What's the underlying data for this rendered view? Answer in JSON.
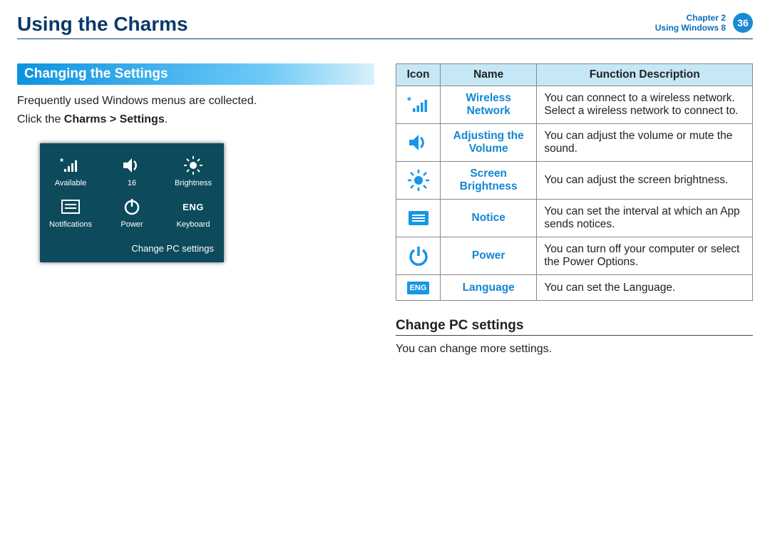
{
  "header": {
    "title": "Using the Charms",
    "chapter_line1": "Chapter 2",
    "chapter_line2": "Using Windows 8",
    "page_number": "36"
  },
  "left": {
    "section_title": "Changing the Settings",
    "intro": "Frequently used Windows menus are collected.",
    "instruction_prefix": "Click the ",
    "instruction_bold": "Charms > Settings",
    "instruction_suffix": ".",
    "screenshot": {
      "items": [
        {
          "label": "Available"
        },
        {
          "label": "16"
        },
        {
          "label": "Brightness"
        },
        {
          "label": "Notifications"
        },
        {
          "label": "Power"
        },
        {
          "label": "Keyboard",
          "text_icon": "ENG"
        }
      ],
      "footer": "Change PC settings"
    }
  },
  "right": {
    "table_headers": {
      "icon": "Icon",
      "name": "Name",
      "desc": "Function Description"
    },
    "rows": [
      {
        "name": "Wireless Network",
        "desc": "You can connect to a wireless network. Select a wireless network to connect to."
      },
      {
        "name": "Adjusting the Volume",
        "desc": "You can adjust the volume or mute the sound."
      },
      {
        "name": "Screen Brightness",
        "desc": "You can adjust the screen brightness."
      },
      {
        "name": "Notice",
        "desc": "You can set the interval at which an App sends notices."
      },
      {
        "name": "Power",
        "desc": "You can turn off your computer or select the Power Options."
      },
      {
        "name": "Language",
        "desc": "You can set the Language.",
        "text_icon": "ENG"
      }
    ],
    "subhead": "Change PC settings",
    "subtext": "You can change more settings."
  }
}
